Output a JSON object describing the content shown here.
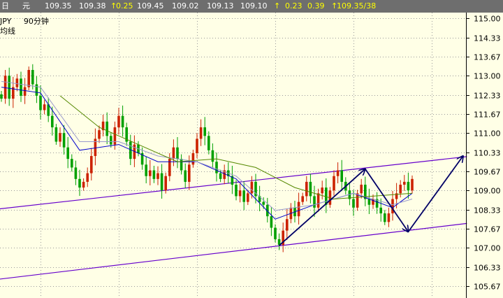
{
  "quote_bar": {
    "period": "日",
    "unit": "元",
    "open": "109.35",
    "last": "109.38",
    "change_arrow": "↑",
    "change": "0.25",
    "high": "109.45",
    "low": "109.02",
    "value5": "109.13",
    "value6": "109.10",
    "arrow2": "↑",
    "value7": "0.23",
    "value8": "0.39",
    "arrow3": "↑",
    "bid_ask": "109.35/38"
  },
  "legend": {
    "symbol_label": "JPY",
    "timeframe_label": "90分钟",
    "indicator_label": "均线"
  },
  "colors": {
    "background": "#ffffe6",
    "quote_bar": "#6e6e6e",
    "candle_up": "#cc2200",
    "candle_down": "#00a000",
    "ma_fast": "#0000cc",
    "ma_mid": "#9999cc",
    "ma_slow": "#558800",
    "channel": "#6600cc",
    "arrows": "#000066",
    "grid": "#999999"
  },
  "chart_data": {
    "type": "candlestick",
    "title": "",
    "xlabel": "",
    "ylabel": "",
    "ylim": [
      105.25,
      115.2
    ],
    "y_ticks": [
      "115.00",
      "114.33",
      "113.67",
      "113.00",
      "112.33",
      "111.67",
      "111.00",
      "110.33",
      "109.67",
      "109.00",
      "108.33",
      "107.67",
      "107.00",
      "106.33",
      "105.67"
    ],
    "grid": true,
    "close_series": [
      112.2,
      113.0,
      112.2,
      112.6,
      112.9,
      112.3,
      112.6,
      113.2,
      112.7,
      112.3,
      111.8,
      112.0,
      111.6,
      111.2,
      110.7,
      111.0,
      110.5,
      110.1,
      109.8,
      109.4,
      109.1,
      109.3,
      109.6,
      110.2,
      110.8,
      111.1,
      111.4,
      110.9,
      110.6,
      111.2,
      111.6,
      111.2,
      110.7,
      110.1,
      110.6,
      110.3,
      109.9,
      109.5,
      109.7,
      109.4,
      109.6,
      109.0,
      109.5,
      110.1,
      110.5,
      110.1,
      109.7,
      109.3,
      109.9,
      110.3,
      110.8,
      111.2,
      110.9,
      110.4,
      110.0,
      109.6,
      109.4,
      109.7,
      109.5,
      109.2,
      108.8,
      109.0,
      108.6,
      108.9,
      109.3,
      108.8,
      108.6,
      108.5,
      108.1,
      107.7,
      107.3,
      107.1,
      107.6,
      108.0,
      108.4,
      108.1,
      108.6,
      108.8,
      109.3,
      108.8,
      108.4,
      108.9,
      109.1,
      108.5,
      109.0,
      109.5,
      109.7,
      109.3,
      109.0,
      108.7,
      108.4,
      108.9,
      109.2,
      108.7,
      108.5,
      108.7,
      108.4,
      108.2,
      107.9,
      108.2,
      108.7,
      108.9,
      109.2,
      109.3,
      109.0,
      109.4
    ],
    "moving_averages": [
      {
        "name": "",
        "points": [
          [
            0,
            112.6
          ],
          [
            10,
            112.4
          ],
          [
            20,
            110.4
          ],
          [
            30,
            110.6
          ],
          [
            40,
            110.0
          ],
          [
            50,
            110.0
          ],
          [
            60,
            109.4
          ],
          [
            70,
            108.0
          ],
          [
            80,
            108.5
          ],
          [
            90,
            108.9
          ],
          [
            100,
            108.4
          ],
          [
            105,
            108.9
          ]
        ]
      },
      {
        "name": "",
        "points": [
          [
            0,
            112.8
          ],
          [
            10,
            112.6
          ],
          [
            20,
            110.7
          ],
          [
            30,
            110.7
          ],
          [
            40,
            110.2
          ],
          [
            50,
            110.0
          ],
          [
            60,
            109.5
          ],
          [
            70,
            108.3
          ],
          [
            80,
            108.5
          ],
          [
            90,
            108.9
          ],
          [
            100,
            108.5
          ],
          [
            105,
            108.7
          ]
        ]
      },
      {
        "name": "",
        "points": [
          [
            15,
            112.3
          ],
          [
            25,
            111.2
          ],
          [
            35,
            110.6
          ],
          [
            45,
            110.0
          ],
          [
            55,
            110.1
          ],
          [
            65,
            109.8
          ],
          [
            75,
            109.1
          ],
          [
            85,
            108.7
          ],
          [
            95,
            108.8
          ],
          [
            105,
            108.9
          ]
        ]
      }
    ],
    "channel_lines": [
      {
        "from": [
          -1,
          108.35
        ],
        "to": [
          119,
          110.18
        ]
      },
      {
        "from": [
          -1,
          105.9
        ],
        "to": [
          119,
          107.85
        ]
      }
    ],
    "trend_arrows": [
      {
        "from": [
          71,
          107.08
        ],
        "to": [
          93,
          109.75
        ]
      },
      {
        "from": [
          93,
          109.75
        ],
        "to": [
          104,
          107.56
        ]
      },
      {
        "from": [
          104,
          107.56
        ],
        "to": [
          118,
          110.2
        ]
      }
    ]
  }
}
